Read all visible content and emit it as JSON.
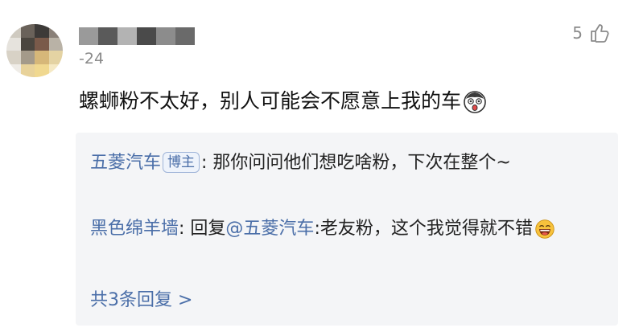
{
  "comment": {
    "date": "-24",
    "text": "螺蛳粉不太好，别人可能会不愿意上我的车",
    "like_count": "5",
    "emoji": "surprised-face-emoji"
  },
  "replies": [
    {
      "author": "五菱汽车",
      "badge": "博主",
      "text": ": 那你问问他们想吃啥粉，下次在整个~"
    },
    {
      "author": "黑色绵羊墙",
      "prefix": ": 回复",
      "mention": "@五菱汽车",
      "text": ":老友粉，这个我觉得就不错",
      "emoji": "laughing-face-emoji"
    }
  ],
  "more_replies": "共3条回复 >",
  "colors": {
    "link": "#4a6ea8",
    "muted": "#8a8a8a",
    "reply_bg": "#f4f5f7"
  }
}
